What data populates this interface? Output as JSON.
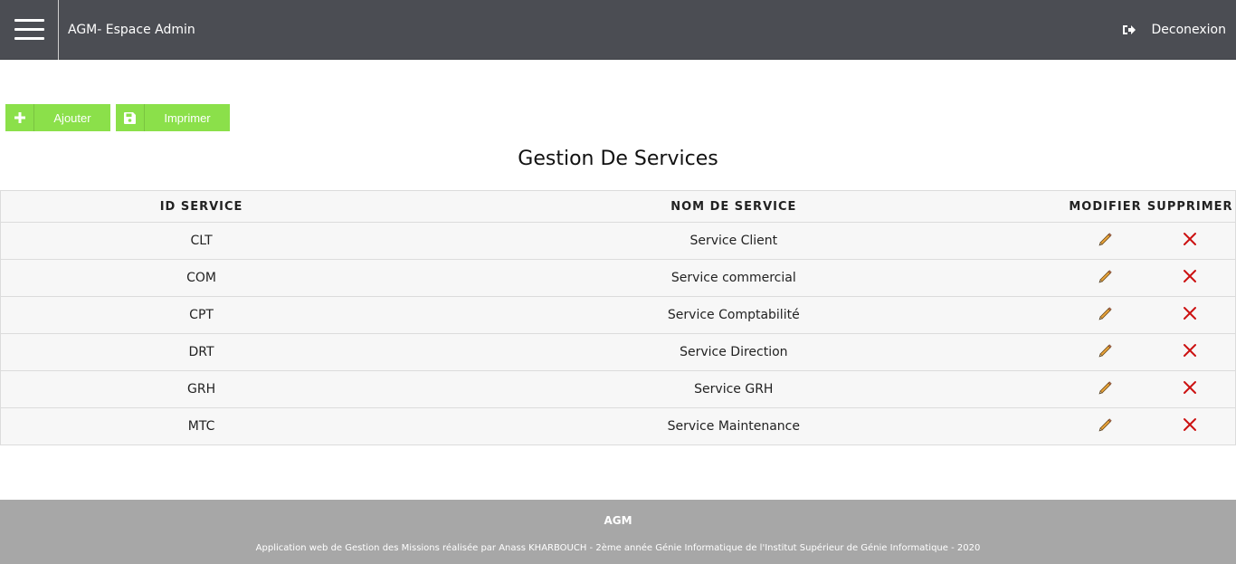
{
  "header": {
    "title": "AGM- Espace Admin",
    "logout_label": "Deconexion"
  },
  "toolbar": {
    "add_label": "Ajouter",
    "print_label": "Imprimer"
  },
  "page_title": "Gestion De Services",
  "table": {
    "columns": [
      "ID SERVICE",
      "NOM DE SERVICE",
      "MODIFIER",
      "SUPPRIMER"
    ],
    "rows": [
      {
        "id": "CLT",
        "name": "Service Client"
      },
      {
        "id": "COM",
        "name": "Service commercial"
      },
      {
        "id": "CPT",
        "name": "Service Comptabilité"
      },
      {
        "id": "DRT",
        "name": "Service Direction"
      },
      {
        "id": "GRH",
        "name": "Service GRH"
      },
      {
        "id": "MTC",
        "name": "Service Maintenance"
      }
    ]
  },
  "footer": {
    "brand": "AGM",
    "text": "Application web de Gestion des Missions réalisée par Anass KHARBOUCH - 2ème année Génie Informatique de l'Institut Supérieur de Génie Informatique - 2020"
  },
  "colors": {
    "topbar": "#4b4d53",
    "button": "#8be04a",
    "footer": "#a7a7a7",
    "delete": "#cc1111"
  },
  "icons": {
    "menu": "hamburger-icon",
    "logout": "sign-out-icon",
    "add": "plus-icon",
    "print": "floppy-disk-icon",
    "edit": "pencil-icon",
    "delete": "cross-icon"
  }
}
